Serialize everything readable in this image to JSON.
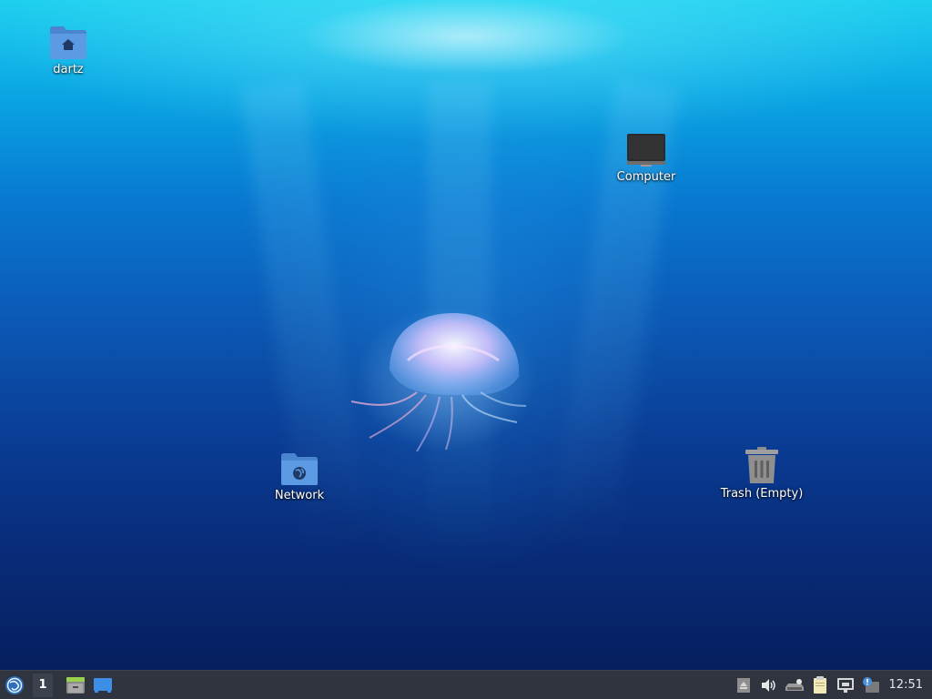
{
  "desktop": {
    "icons": [
      {
        "id": "home",
        "label": "dartz",
        "icon": "home-folder-icon"
      },
      {
        "id": "computer",
        "label": "Computer",
        "icon": "computer-icon"
      },
      {
        "id": "network",
        "label": "Network",
        "icon": "network-folder-icon"
      },
      {
        "id": "trash",
        "label": "Trash (Empty)",
        "icon": "trash-icon"
      }
    ]
  },
  "panel": {
    "menu_icon": "xfce-menu-icon",
    "workspace_label": "1",
    "launchers": [
      {
        "icon": "file-manager-icon"
      },
      {
        "icon": "show-desktop-icon"
      }
    ],
    "tray": [
      {
        "icon": "eject-icon"
      },
      {
        "icon": "volume-icon"
      },
      {
        "icon": "power-manager-icon"
      },
      {
        "icon": "clipboard-icon"
      },
      {
        "icon": "network-wired-icon"
      },
      {
        "icon": "updates-notification-icon"
      }
    ],
    "clock": "12:51"
  },
  "colors": {
    "panel_bg": "#2f343f",
    "folder_blue": "#5294e2",
    "wallpaper_top": "#1fd0ef",
    "wallpaper_bottom": "#061f5e"
  }
}
